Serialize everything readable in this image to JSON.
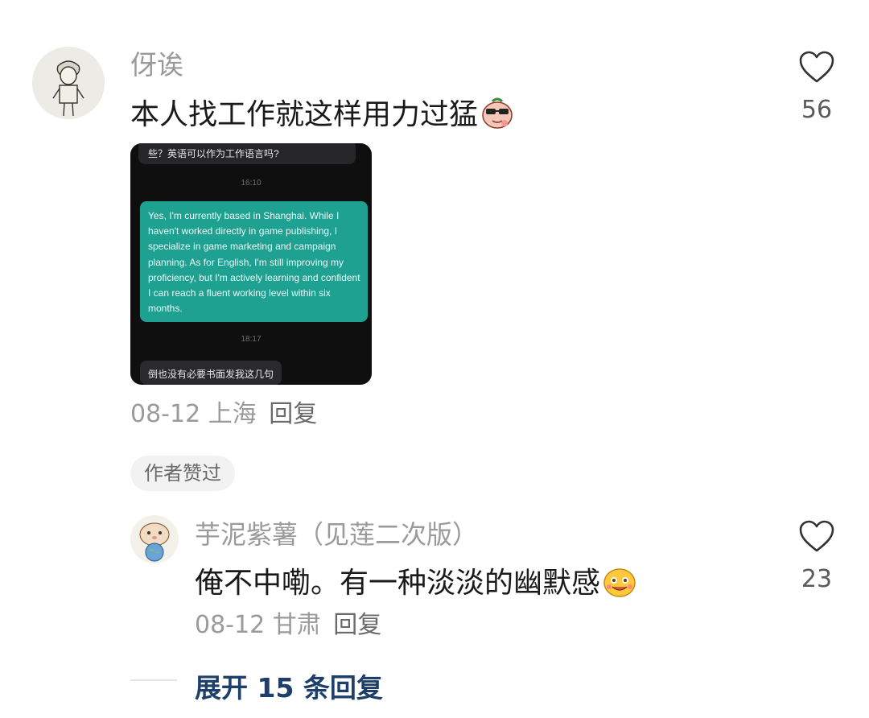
{
  "comment": {
    "username": "伢诶",
    "text": "本人找工作就这样用力过猛",
    "likes": "56",
    "date": "08-12",
    "location": "上海",
    "reply_label": "回复",
    "attachment": {
      "top_text": "些？英语可以作为工作语言吗?",
      "time1": "16:10",
      "message": "Yes, I'm currently based in Shanghai. While I haven't worked directly in game publishing, I specialize in game marketing and campaign planning. As for English, I'm still improving my proficiency, but I'm actively learning and confident I can reach a fluent working level within six months.",
      "time2": "18:17",
      "bottom_text": "倒也没有必要书面发我这几句"
    }
  },
  "author_badge": "作者赞过",
  "reply": {
    "username": "芋泥紫薯（见莲二次版）",
    "text": "俺不中嘞。有一种淡淡的幽默感",
    "likes": "23",
    "date": "08-12",
    "location": "甘肃",
    "reply_label": "回复"
  },
  "expand": {
    "label": "展开 15 条回复"
  },
  "icons": {
    "like": "heart-outline-icon",
    "emoji1": "sunglasses-bean-emoji-icon",
    "emoji2": "smiling-face-emoji-icon"
  },
  "colors": {
    "expand_link": "#1f3f6b",
    "bubble_green": "#1fa192"
  }
}
